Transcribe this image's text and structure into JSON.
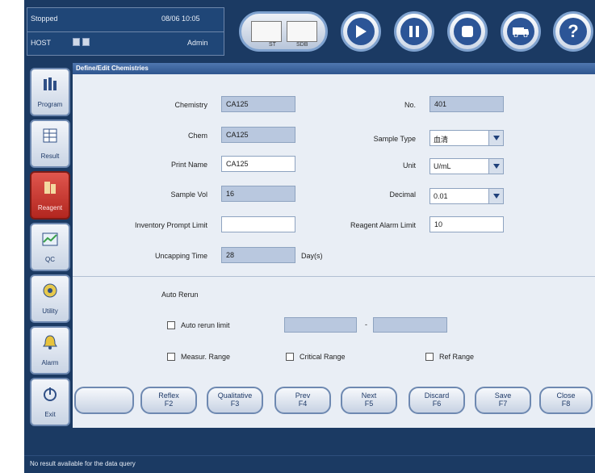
{
  "header": {
    "status": "Stopped",
    "datetime": "08/06 10:05",
    "host": "HOST",
    "user": "Admin",
    "sample_labels": [
      "ST",
      "SDB"
    ],
    "buttons": [
      "sample-overview",
      "play",
      "pause",
      "stop",
      "ambulance",
      "help"
    ],
    "help_glyph": "?"
  },
  "sidebar": {
    "items": [
      {
        "label": "Program",
        "icon": "program-icon"
      },
      {
        "label": "Result",
        "icon": "result-icon"
      },
      {
        "label": "Reagent",
        "icon": "reagent-icon",
        "active": true
      },
      {
        "label": "QC",
        "icon": "qc-icon"
      },
      {
        "label": "Utility",
        "icon": "utility-icon"
      },
      {
        "label": "Alarm",
        "icon": "alarm-icon"
      },
      {
        "label": "Exit",
        "icon": "exit-icon"
      }
    ]
  },
  "panel": {
    "title": "Define/Edit Chemistries",
    "fields": {
      "chemistry": {
        "label": "Chemistry",
        "value": "CA125"
      },
      "chem": {
        "label": "Chem",
        "value": "CA125"
      },
      "print_name": {
        "label": "Print Name",
        "value": "CA125"
      },
      "sample_vol": {
        "label": "Sample Vol",
        "value": "16"
      },
      "inventory_prompt_limit": {
        "label": "Inventory Prompt Limit",
        "value": ""
      },
      "uncapping_time": {
        "label": "Uncapping Time",
        "value": "28",
        "unit": "Day(s)"
      },
      "no": {
        "label": "No.",
        "value": "401"
      },
      "sample_type": {
        "label": "Sample Type",
        "value": "血清"
      },
      "unit": {
        "label": "Unit",
        "value": "U/mL"
      },
      "decimal": {
        "label": "Decimal",
        "value": "0.01"
      },
      "reagent_alarm_limit": {
        "label": "Reagent Alarm Limit",
        "value": "10"
      }
    },
    "auto_rerun": {
      "title": "Auto Rerun",
      "limit_label": "Auto rerun limit",
      "range_separator": "-",
      "measur_range": "Measur. Range",
      "critical_range": "Critical Range",
      "ref_range": "Ref Range"
    }
  },
  "fkeys": [
    {
      "label": "",
      "key": ""
    },
    {
      "label": "Reflex",
      "key": "F2"
    },
    {
      "label": "Qualitative",
      "key": "F3"
    },
    {
      "label": "Prev",
      "key": "F4"
    },
    {
      "label": "Next",
      "key": "F5"
    },
    {
      "label": "Discard",
      "key": "F6"
    },
    {
      "label": "Save",
      "key": "F7"
    },
    {
      "label": "Close",
      "key": "F8"
    }
  ],
  "status_bar": {
    "message": "No result available for the data query"
  }
}
